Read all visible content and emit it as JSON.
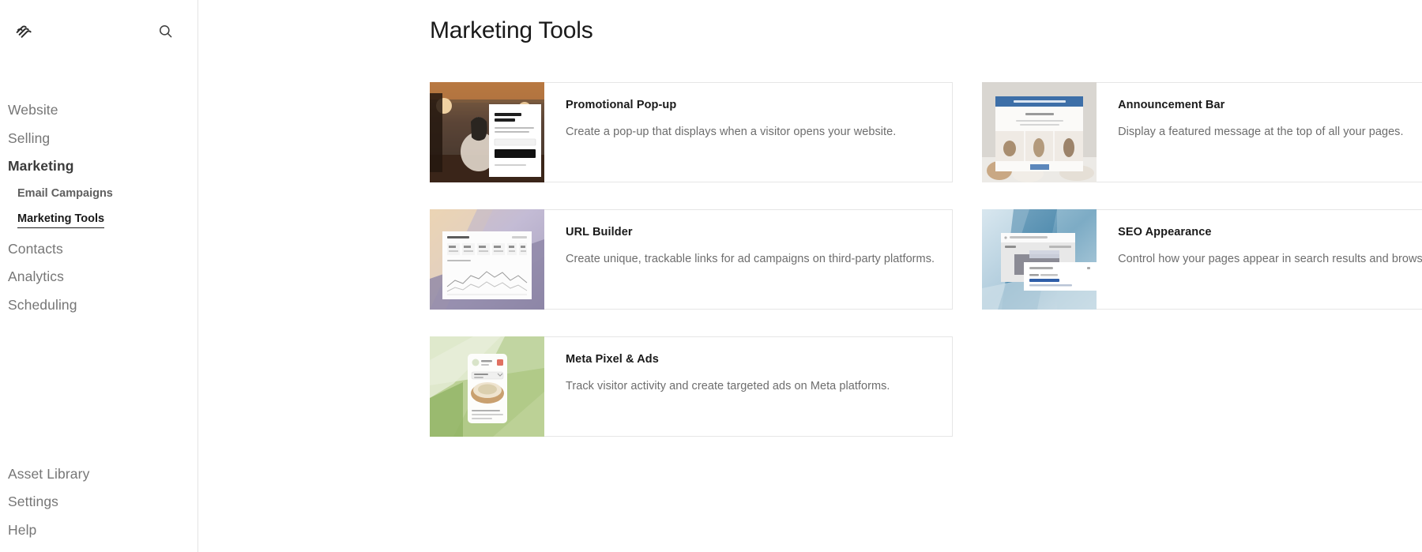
{
  "sidebar": {
    "logo_icon": "squarespace-logo",
    "search_icon": "search-icon",
    "primary_items": [
      {
        "label": "Website",
        "strong": false
      },
      {
        "label": "Selling",
        "strong": false
      },
      {
        "label": "Marketing",
        "strong": true
      }
    ],
    "sub_items": [
      {
        "label": "Email Campaigns",
        "active": false
      },
      {
        "label": "Marketing Tools",
        "active": true
      }
    ],
    "after_items": [
      {
        "label": "Contacts"
      },
      {
        "label": "Analytics"
      },
      {
        "label": "Scheduling"
      }
    ],
    "bottom_items": [
      {
        "label": "Asset Library"
      },
      {
        "label": "Settings"
      },
      {
        "label": "Help"
      }
    ]
  },
  "main": {
    "title": "Marketing Tools",
    "cards": [
      {
        "title": "Promotional Pop-up",
        "description": "Create a pop-up that displays when a visitor opens your website.",
        "thumb": "popup-yoga-photo"
      },
      {
        "title": "Announcement Bar",
        "description": "Display a featured message at the top of all your pages.",
        "thumb": "announcement-bar-store-photo"
      },
      {
        "title": "URL Builder",
        "description": "Create unique, trackable links for ad campaigns on third-party platforms.",
        "thumb": "url-builder-analytics-photo"
      },
      {
        "title": "SEO Appearance",
        "description": "Control how your pages appear in search results and browser tabs.",
        "thumb": "seo-search-results-photo"
      },
      {
        "title": "Meta Pixel & Ads",
        "description": "Track visitor activity and create targeted ads on Meta platforms.",
        "thumb": "meta-pixel-mobile-ad-photo"
      }
    ]
  },
  "colors": {
    "text_primary": "#1a1a1a",
    "text_muted": "#767676",
    "border": "#e6e6e6",
    "accent_blue": "#3d6fa8"
  }
}
